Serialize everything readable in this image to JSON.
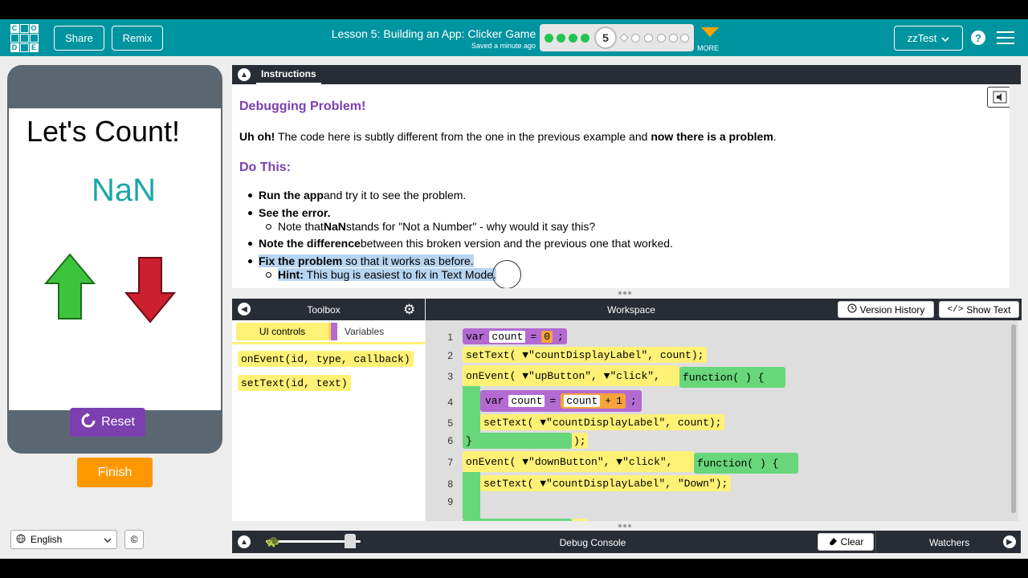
{
  "header": {
    "logo_letters": [
      "C",
      "O",
      "D",
      "E"
    ],
    "share": "Share",
    "remix": "Remix",
    "lesson_title": "Lesson 5: Building an App: Clicker Game",
    "saved": "Saved a minute ago",
    "progress": {
      "completed": 4,
      "current": "5",
      "remaining": 6
    },
    "more": "MORE",
    "user": "zzTest",
    "help": "?"
  },
  "app": {
    "title": "Let's Count!",
    "count": "NaN",
    "reset": "Reset",
    "finish": "Finish",
    "up_color": "#2db52d",
    "down_color": "#c0152a"
  },
  "footer": {
    "language": "English",
    "cc": "©"
  },
  "instructions": {
    "tab": "Instructions",
    "heading1": "Debugging Problem!",
    "p1_bold1": "Uh oh!",
    "p1_text": " The code here is subtly different from the one in the previous example and ",
    "p1_bold2": "now there is a problem",
    "p1_end": ".",
    "heading2": "Do This:",
    "b1_bold": "Run the app",
    "b1_text": " and try it to see the problem.",
    "b2_bold": "See the error.",
    "s1_pre": "Note that ",
    "s1_bold": "NaN",
    "s1_text": " stands for \"Not a Number\" - why would it say this?",
    "b3_bold": "Note the difference",
    "b3_text": " between this broken version and the previous one that worked.",
    "b4_bold": "Fix the problem",
    "b4_text": " so that it works as before.",
    "s2_bold": "Hint:",
    "s2_text": " This bug is easiest to fix in Text Mode."
  },
  "toolbox": {
    "title": "Toolbox",
    "cat_ui": "UI controls",
    "cat_vars": "Variables",
    "block1": "onEvent(id, type, callback)",
    "block2": "setText(id, text)"
  },
  "workspace": {
    "title": "Workspace",
    "version_history": "Version History",
    "show_text": "Show Text",
    "lines": [
      "1",
      "2",
      "3",
      "4",
      "5",
      "6",
      "7",
      "8",
      "9"
    ],
    "code": {
      "l1_var": "var",
      "l1_name": "count",
      "l1_eq": "=",
      "l1_val": "0",
      "l1_end": ";",
      "l2": "setText(",
      "l2_id": "\"countDisplayLabel\"",
      "l2_rest": ", count);",
      "l3": "onEvent(",
      "l3_id": "\"upButton\"",
      "l3_ev": "\"click\"",
      "l3_fn": "function( ) {",
      "l4_var": "var",
      "l4_name": "count",
      "l4_eq": "=",
      "l4_a": "count",
      "l4_plus": "+",
      "l4_b": "1",
      "l4_end": ";",
      "l5": "setText(",
      "l5_id": "\"countDisplayLabel\"",
      "l5_rest": ", count);",
      "l6": "}",
      "l6_end": ");",
      "l7": "onEvent(",
      "l7_id": "\"downButton\"",
      "l7_ev": "\"click\"",
      "l7_fn": "function( ) {",
      "l8": "setText(",
      "l8_id": "\"countDisplayLabel\"",
      "l8_rest": ", \"Down\");",
      "l9": "}",
      "l9_end": ");"
    }
  },
  "debug": {
    "title": "Debug Console",
    "clear": "Clear",
    "watchers": "Watchers"
  }
}
